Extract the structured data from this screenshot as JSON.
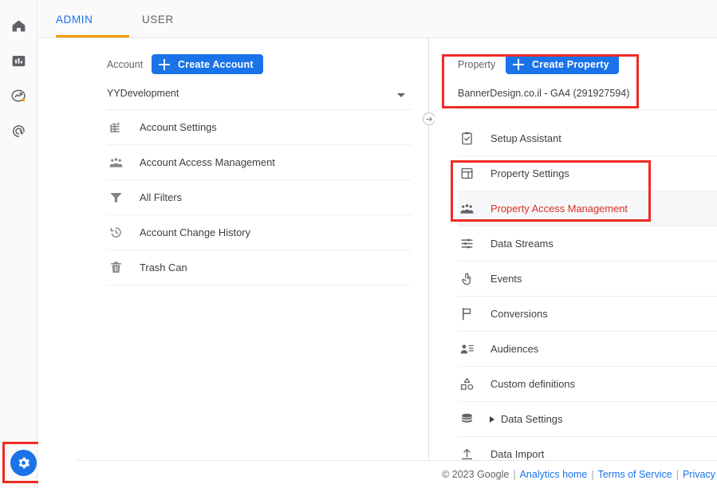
{
  "app": {
    "footer_copyright": "© 2023 Google",
    "footer_links": [
      "Analytics home",
      "Terms of Service",
      "Privacy Policy"
    ],
    "accent_blue": "#1a73e8",
    "accent_orange": "#f29900",
    "annotation_red": "#ee2b24",
    "highlight_red_text": "#d93025"
  },
  "rail": {
    "items": [
      {
        "name": "home-icon",
        "label": "Home"
      },
      {
        "name": "reports-icon",
        "label": "Reports"
      },
      {
        "name": "explore-icon",
        "label": "Explore"
      },
      {
        "name": "advertising-icon",
        "label": "Advertising"
      }
    ],
    "settings": {
      "name": "gear-icon",
      "label": "Admin"
    }
  },
  "tabs": [
    {
      "label": "ADMIN",
      "active": true
    },
    {
      "label": "USER",
      "active": false
    }
  ],
  "account": {
    "header_label": "Account",
    "create_button": "Create Account",
    "selected": "YYDevelopment",
    "items": [
      {
        "label": "Account Settings",
        "icon": "building-icon"
      },
      {
        "label": "Account Access Management",
        "icon": "people-icon"
      },
      {
        "label": "All Filters",
        "icon": "funnel-icon"
      },
      {
        "label": "Account Change History",
        "icon": "history-icon"
      },
      {
        "label": "Trash Can",
        "icon": "trash-icon"
      }
    ]
  },
  "property": {
    "header_label": "Property",
    "create_button": "Create Property",
    "selected": "BannerDesign.co.il - GA4 (291927594)",
    "items": [
      {
        "label": "Setup Assistant",
        "icon": "clipboard-check-icon"
      },
      {
        "label": "Property Settings",
        "icon": "window-icon"
      },
      {
        "label": "Property Access Management",
        "icon": "people-icon"
      },
      {
        "label": "Data Streams",
        "icon": "streams-icon"
      },
      {
        "label": "Events",
        "icon": "tap-icon"
      },
      {
        "label": "Conversions",
        "icon": "flag-icon"
      },
      {
        "label": "Audiences",
        "icon": "audience-icon"
      },
      {
        "label": "Custom definitions",
        "icon": "shapes-icon"
      },
      {
        "label": "Data Settings",
        "icon": "database-icon"
      },
      {
        "label": "Data Import",
        "icon": "upload-icon"
      }
    ]
  },
  "collapse_button": {
    "name": "collapse-panel-arrow-icon"
  }
}
